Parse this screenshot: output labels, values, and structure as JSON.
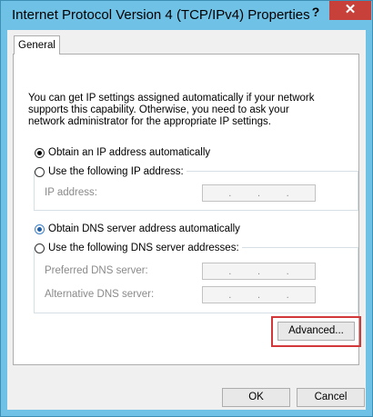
{
  "window": {
    "title": "Internet Protocol Version 4 (TCP/IPv4) Properties",
    "help_icon": "?",
    "close_icon": "✕"
  },
  "tabs": [
    {
      "label": "General",
      "selected": true
    }
  ],
  "intro_text": "You can get IP settings assigned automatically if your network supports this capability. Otherwise, you need to ask your network administrator for the appropriate IP settings.",
  "ip_section": {
    "auto_label": "Obtain an IP address automatically",
    "auto_checked": true,
    "manual_label": "Use the following IP address:",
    "manual_checked": false,
    "fields": [
      {
        "label": "IP address:",
        "value": ". . ."
      }
    ]
  },
  "dns_section": {
    "auto_label": "Obtain DNS server address automatically",
    "auto_checked": true,
    "manual_label": "Use the following DNS server addresses:",
    "manual_checked": false,
    "fields": [
      {
        "label": "Preferred DNS server:",
        "value": ". . ."
      },
      {
        "label": "Alternative DNS server:",
        "value": ". . ."
      }
    ]
  },
  "buttons": {
    "advanced": "Advanced...",
    "ok": "OK",
    "cancel": "Cancel"
  },
  "colors": {
    "title_bar": "#6fc1e6",
    "close_button": "#c7403a",
    "highlight_box": "#d2373a"
  }
}
